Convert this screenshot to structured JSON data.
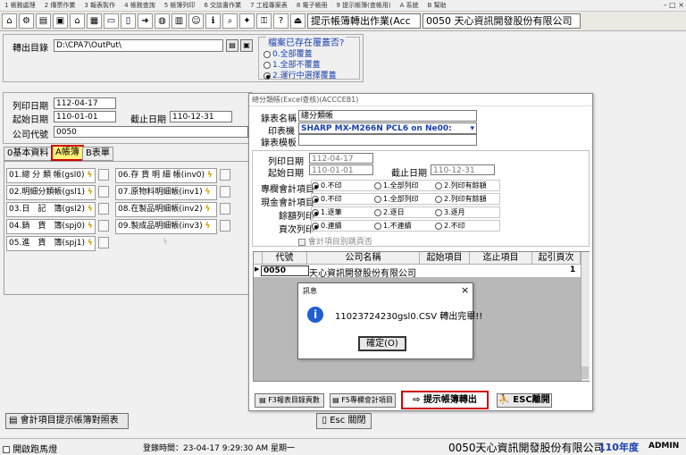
{
  "menu": {
    "items": [
      "1 帳務處理",
      "2 傳票作業",
      "3 報表製作",
      "4 帳務查詢",
      "5 帳簿列印",
      "6 交談書作業",
      "7 工程專案表",
      "8 電子帳冊",
      "9 提示帳簿(查帳用)",
      "A 系統",
      "B 幫助"
    ],
    "controls": "– □ ×"
  },
  "toolbar": {
    "combo_program": "提示帳簿轉出作業(Acc",
    "combo_company": "0050 天心資訊開發股份有限公司"
  },
  "export": {
    "dir_label": "轉出目錄",
    "dir_value": "D:\\CPA7\\OutPut\\",
    "overwrite_title": "檔案已存在覆蓋否?",
    "options": [
      "0.全部覆蓋",
      "1.全部不覆蓋",
      "2.運行中選擇覆蓋"
    ]
  },
  "params": {
    "print_date_label": "列印日期",
    "print_date": "112-04-17",
    "start_date_label": "起始日期",
    "start_date": "110-01-01",
    "end_date_label": "截止日期",
    "end_date": "110-12-31",
    "company_label": "公司代號",
    "company": "0050"
  },
  "tabs": [
    "0基本資料",
    "A帳簿",
    "B表單"
  ],
  "ledgers": {
    "left": [
      "01.總 分 類 帳(gsl0)",
      "02.明細分類帳(gsl1)",
      "03.日　記　簿(gsl2)",
      "04.銷　貨　簿(spj0)",
      "05.進　貨　簿(spj1)"
    ],
    "right": [
      "06.存 貨 明 細 帳(inv0)",
      "07.原物料明細帳(inv1)",
      "08.在製品明細帳(inv2)",
      "09.製成品明細帳(inv3)"
    ]
  },
  "bottom_buttons": {
    "mapping": "會計項目提示帳簿對照表",
    "esc_close": "Esc 關閉"
  },
  "dialog": {
    "title": "總分類帳(Excel查核)(ACCCEB1)",
    "report_name_label": "錄表名稱",
    "report_name": "總分類帳",
    "printer_label": "印表機",
    "printer": "SHARP MX-M266N PCL6 on Ne00:",
    "template_label": "錄表模板",
    "print_date_label": "列印日期",
    "print_date": "112-04-17",
    "start_date_label": "起始日期",
    "start_date": "110-01-01",
    "end_date_label": "截止日期",
    "end_date": "110-12-31",
    "opt_rows": [
      {
        "label": "專欄會計項目",
        "opts": [
          "0.不印",
          "1.全部列印",
          "2.列印有餘額"
        ]
      },
      {
        "label": "現金會計項目",
        "opts": [
          "0.不印",
          "1.全部列印",
          "2.列印有餘額"
        ]
      },
      {
        "label": "餘額列印",
        "opts": [
          "1.逐筆",
          "2.逐日",
          "3.逐月"
        ]
      },
      {
        "label": "頁次列印",
        "opts": [
          "0.連續",
          "1.不連續",
          "2.不印"
        ]
      }
    ],
    "skip_page": "會計項目別跳頁否",
    "grid_headers": [
      "代號",
      "公司名稱",
      "起始項目",
      "迄止項目",
      "起引頁次"
    ],
    "grid_row": {
      "code": "0050",
      "name": "天心資訊開發股份有限公司",
      "page": "1"
    },
    "btn_f3": "F3報表目錄頁數",
    "btn_f5": "F5專欄會計項目",
    "btn_export": "提示帳簿轉出",
    "btn_esc": "ESC離開"
  },
  "msgbox": {
    "title": "訊息",
    "message": "11023724230gsl0.CSV 轉出完畢!!",
    "ok": "確定(O)",
    "close": "×"
  },
  "status": {
    "autostart": "開啟跑馬燈",
    "login": "登錄時間：23-04-17 9:29:30 AM 星期一",
    "company": "0050天心資訊開發股份有限公司",
    "year": "110年度",
    "user": "ADMIN"
  },
  "colors": {
    "accent_red": "#d00000",
    "title_blue": "#1a3fb0",
    "tab_yellow": "#fff27a"
  }
}
